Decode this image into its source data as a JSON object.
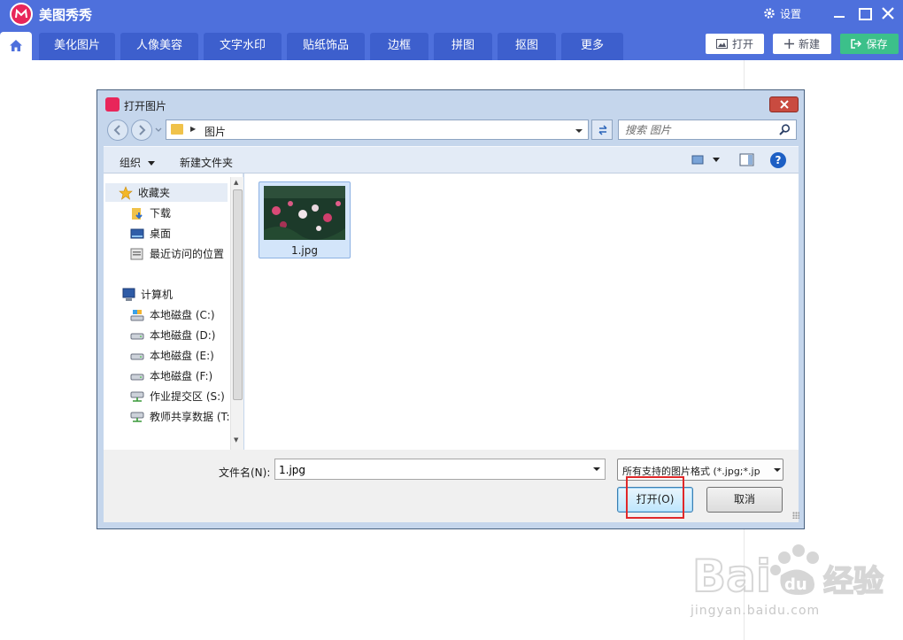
{
  "app": {
    "name": "美图秀秀",
    "settings_label": "设置"
  },
  "tabs": [
    {
      "label": "美化图片"
    },
    {
      "label": "人像美容"
    },
    {
      "label": "文字水印"
    },
    {
      "label": "贴纸饰品"
    },
    {
      "label": "边框"
    },
    {
      "label": "拼图"
    },
    {
      "label": "抠图"
    },
    {
      "label": "更多"
    }
  ],
  "top_buttons": {
    "open": "打开",
    "new": "新建",
    "save": "保存"
  },
  "dialog": {
    "title": "打开图片",
    "address": "图片",
    "search_placeholder": "搜索 图片",
    "organize": "组织",
    "new_folder": "新建文件夹",
    "nav": {
      "favorites": "收藏夹",
      "downloads": "下载",
      "desktop": "桌面",
      "recent": "最近访问的位置",
      "computer": "计算机",
      "drives": [
        {
          "label": "本地磁盘 (C:)"
        },
        {
          "label": "本地磁盘 (D:)"
        },
        {
          "label": "本地磁盘 (E:)"
        },
        {
          "label": "本地磁盘 (F:)"
        },
        {
          "label": "作业提交区 (S:)"
        },
        {
          "label": "教师共享数据 (T:"
        }
      ]
    },
    "file": {
      "name": "1.jpg"
    },
    "filename_label": "文件名(N):",
    "filename_value": "1.jpg",
    "filter": "所有支持的图片格式 (*.jpg;*.jp",
    "open_button": "打开(O)",
    "cancel_button": "取消"
  },
  "watermark": {
    "logo_text": "Baidu经验",
    "url": "jingyan.baidu.com"
  },
  "colors": {
    "app_bar": "#4e70dc",
    "tab_bg": "#3d5fcd",
    "save_green": "#3cc08a",
    "logo_pink": "#e8265a",
    "highlight_red": "#e0282a"
  }
}
